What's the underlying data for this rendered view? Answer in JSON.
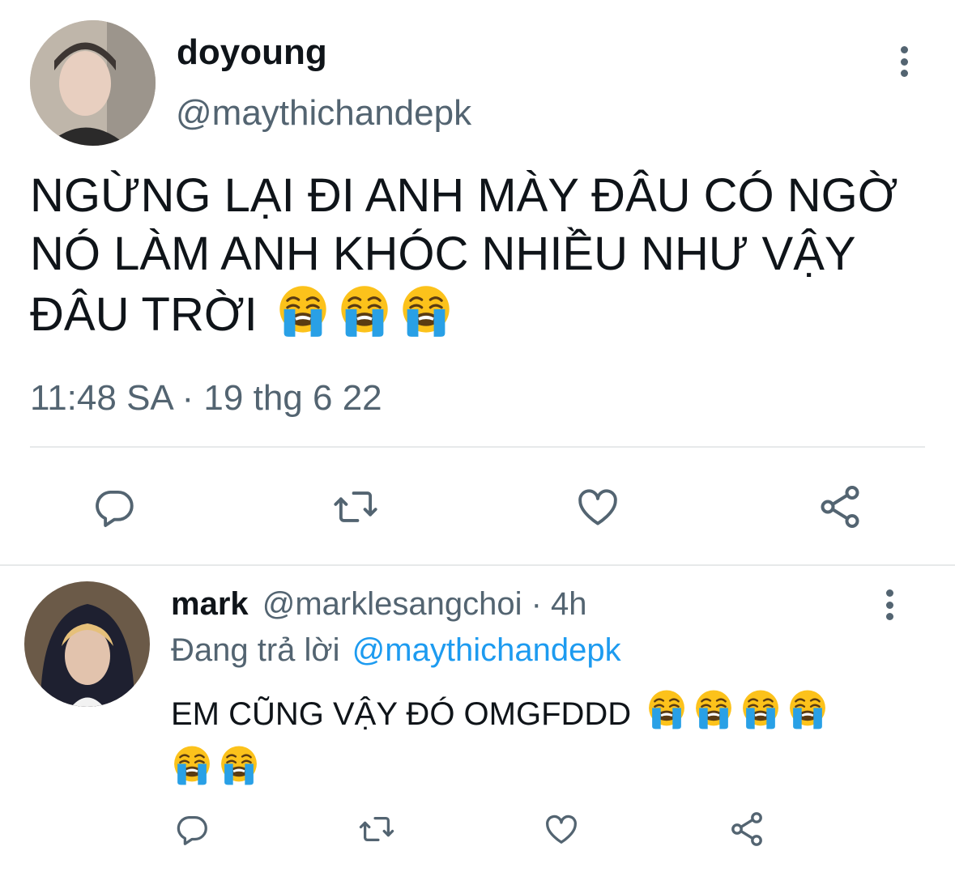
{
  "main_tweet": {
    "author_name": "doyoung",
    "author_handle": "@maythichandepk",
    "text_lines": [
      "NGỪNG LẠI ĐI ANH MÀY ĐÂU CÓ NGỜ",
      "NÓ LÀM ANH KHÓC NHIỀU NHƯ VẬY",
      "ĐÂU TRỜI"
    ],
    "emoji_icon": "loudly-crying-face",
    "emoji_count": 3,
    "timestamp": "11:48 SA · 19 thg 6 22"
  },
  "reply": {
    "author_name": "mark",
    "meta": "@marklesangchoi · 4h",
    "replying_label": "Đang trả lời",
    "replying_to": "@maythichandepk",
    "text": "EM CŨNG VẬY ĐÓ OMGFDDD",
    "emoji_icon": "loudly-crying-face",
    "emoji_count": 6
  },
  "actions": {
    "icons": [
      "reply-icon",
      "retweet-icon",
      "like-icon",
      "share-icon"
    ]
  },
  "colors": {
    "text": "#0f1419",
    "secondary": "#536471",
    "link": "#1d9bf0",
    "divider": "#e7e9ea",
    "emoji_face": "#fcc21b",
    "emoji_tears": "#29a0e6"
  }
}
